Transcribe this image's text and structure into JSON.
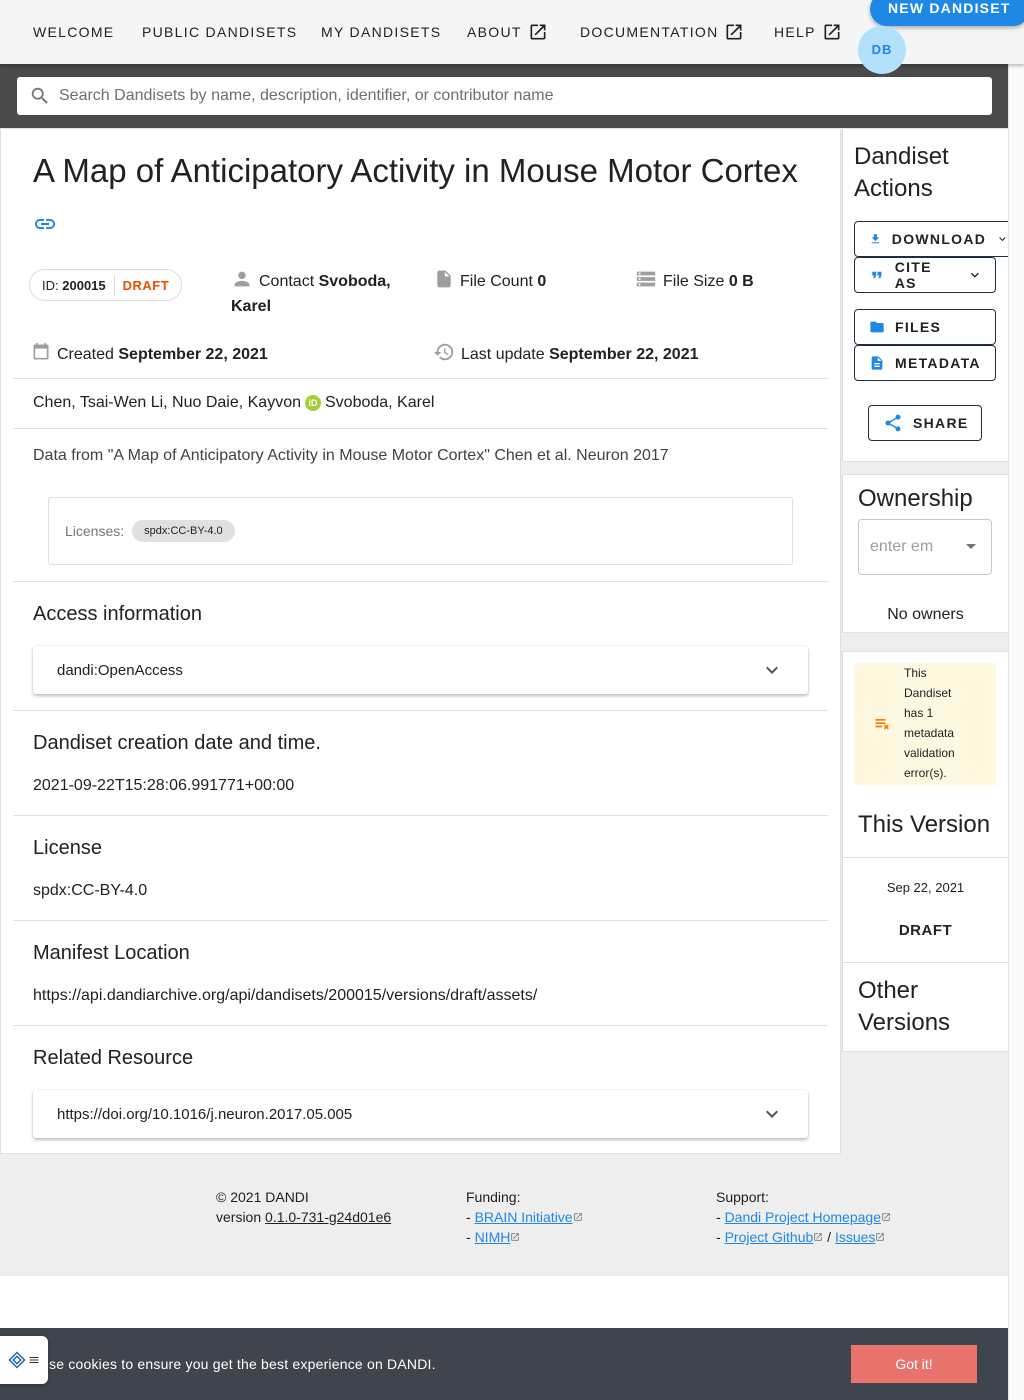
{
  "nav": {
    "items": [
      {
        "label": "WELCOME",
        "external": false
      },
      {
        "label": "PUBLIC DANDISETS",
        "external": false
      },
      {
        "label": "MY DANDISETS",
        "external": false
      },
      {
        "label": "ABOUT",
        "external": true
      },
      {
        "label": "DOCUMENTATION",
        "external": true
      },
      {
        "label": "HELP",
        "external": true
      }
    ],
    "new_dandiset_label": "NEW DANDISET",
    "avatar_initials": "DB"
  },
  "search": {
    "placeholder": "Search Dandisets by name, description, identifier, or contributor name"
  },
  "dandiset": {
    "title": "A Map of Anticipatory Activity in Mouse Motor Cortex",
    "id_label": "ID:",
    "id": "200015",
    "status": "DRAFT",
    "contact_label": "Contact",
    "contact_name_line1": "Svoboda,",
    "contact_name_line2": "Karel",
    "file_count_label": "File Count",
    "file_count": "0",
    "file_size_label": "File Size",
    "file_size": "0 B",
    "created_label": "Created",
    "created": "September 22, 2021",
    "updated_label": "Last update",
    "updated": "September 22, 2021",
    "contributors_before_orcid": "Chen, Tsai-Wen Li, Nuo Daie, Kayvon",
    "orcid_badge": "iD",
    "contributors_after_orcid": "Svoboda, Karel",
    "description": "Data from \"A Map of Anticipatory Activity in Mouse Motor Cortex\" Chen et al. Neuron 2017",
    "licenses_label": "Licenses:",
    "license_chip": "spdx:CC-BY-4.0"
  },
  "sections": {
    "access_title": "Access information",
    "access_value": "dandi:OpenAccess",
    "creation_title": "Dandiset creation date and time.",
    "creation_value": "2021-09-22T15:28:06.991771+00:00",
    "license_title": "License",
    "license_value": "spdx:CC-BY-4.0",
    "manifest_title": "Manifest Location",
    "manifest_value": "https://api.dandiarchive.org/api/dandisets/200015/versions/draft/assets/",
    "related_title": "Related Resource",
    "related_value": "https://doi.org/10.1016/j.neuron.2017.05.005"
  },
  "actions": {
    "title_line1": "Dandiset",
    "title_line2": "Actions",
    "download": "DOWNLOAD",
    "cite": "CITE AS",
    "files": "FILES",
    "metadata": "METADATA",
    "share": "SHARE"
  },
  "ownership": {
    "title": "Ownership",
    "select_placeholder": "enter em",
    "no_owners": "No owners"
  },
  "version": {
    "warning_lines": [
      "This",
      "Dandiset",
      "has 1",
      "metadata",
      "validation",
      "error(s)."
    ],
    "this_version_title": "This Version",
    "date": "Sep 22, 2021",
    "status": "DRAFT",
    "other_versions_line1": "Other",
    "other_versions_line2": "Versions"
  },
  "footer": {
    "copyright": "© 2021 DANDI",
    "version_label": "version",
    "version": "0.1.0-731-g24d01e6",
    "funding_title": "Funding:",
    "funding_links": [
      "BRAIN Initiative",
      "NIMH"
    ],
    "support_title": "Support:",
    "support_home": "Dandi Project Homepage",
    "support_github": "Project Github",
    "support_issues": "Issues",
    "dash": "-",
    "slash": "/"
  },
  "cookie": {
    "text": "se cookies to ensure you get the best experience on DANDI.",
    "button": "Got it!"
  },
  "colors": {
    "primary": "#1e88e5",
    "draft": "#e65100",
    "warning_bg": "#fef8e1",
    "warning_icon": "#f57c00",
    "cookie_bg": "#3f444d",
    "cookie_btn": "#e8736d"
  }
}
